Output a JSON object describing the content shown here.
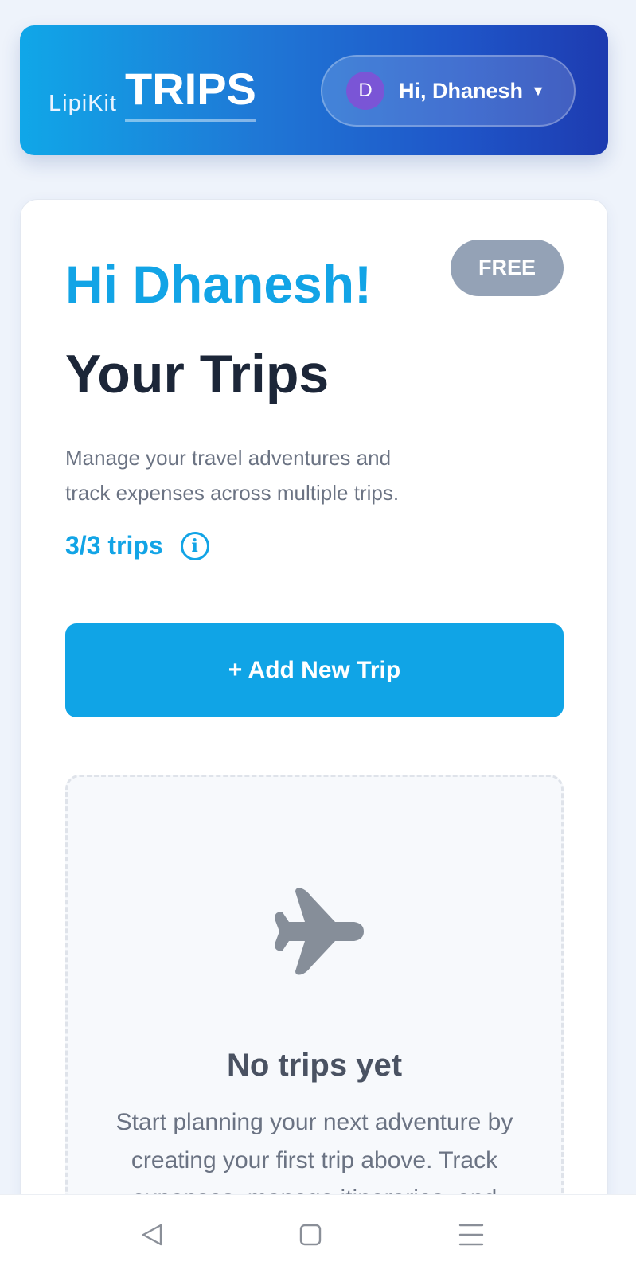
{
  "header": {
    "logo_small": "LipiKit",
    "logo_big": "TRIPS",
    "user": {
      "avatar_initial": "D",
      "greeting": "Hi, Dhanesh",
      "menu_caret": "▼"
    }
  },
  "main": {
    "plan_badge": "FREE",
    "greeting": "Hi Dhanesh!",
    "title": "Your Trips",
    "description": "Manage your travel adventures and track expenses across multiple trips.",
    "trip_count": "3/3 trips",
    "info_icon_glyph": "i",
    "add_trip_label": "+ Add New Trip",
    "empty_state": {
      "icon": "airplane-icon",
      "title": "No trips yet",
      "description": "Start planning your next adventure by creating your first trip above. Track expenses, manage itineraries, and"
    }
  },
  "nav_bar": {
    "icons": [
      "back-icon",
      "home-icon",
      "recents-icon"
    ]
  },
  "colors": {
    "accent": "#10a4e6",
    "header_gradient_start": "#10a7e8",
    "header_gradient_end": "#1d3bb0",
    "badge": "#94a2b6",
    "avatar": "#7a55d6",
    "title_text": "#1c2638",
    "muted_text": "#6b7383"
  }
}
